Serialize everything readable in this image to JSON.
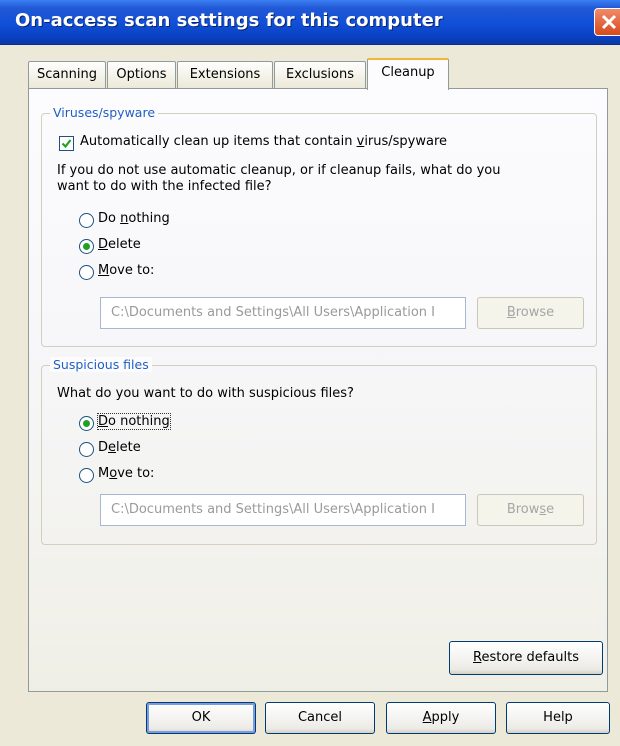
{
  "window": {
    "title": "On-access scan settings for this computer"
  },
  "tabs": [
    {
      "label": "Scanning"
    },
    {
      "label": "Options"
    },
    {
      "label": "Extensions"
    },
    {
      "label": "Exclusions"
    },
    {
      "label": "Cleanup"
    }
  ],
  "active_tab": "Cleanup",
  "viruses": {
    "legend": "Viruses/spyware",
    "auto_clean": {
      "pre": "Automatically clean up items that contain ",
      "accel": "v",
      "post": "irus/spyware",
      "checked": true
    },
    "question_line1": "If you do not use automatic cleanup, or if cleanup fails, what do you",
    "question_line2": "want to do with the infected file?",
    "options": [
      {
        "pre": "Do ",
        "accel": "n",
        "post": "othing",
        "selected": false
      },
      {
        "pre": "",
        "accel": "D",
        "post": "elete",
        "selected": true
      },
      {
        "pre": "",
        "accel": "M",
        "post": "ove to:",
        "selected": false
      }
    ],
    "path_value": "C:\\Documents and Settings\\All Users\\Application I",
    "browse": {
      "pre": "",
      "accel": "B",
      "post": "rowse",
      "enabled": false
    }
  },
  "suspicious": {
    "legend": "Suspicious files",
    "question": "What do you want to do with suspicious files?",
    "options": [
      {
        "pre": "",
        "accel": "D",
        "post": "o nothing",
        "selected": true
      },
      {
        "pre": "D",
        "accel": "e",
        "post": "lete",
        "selected": false
      },
      {
        "pre": "M",
        "accel": "o",
        "post": "ve to:",
        "selected": false
      }
    ],
    "path_value": "C:\\Documents and Settings\\All Users\\Application I",
    "browse": {
      "pre": "Brow",
      "accel": "s",
      "post": "e",
      "enabled": false
    }
  },
  "restore_defaults": {
    "pre": "",
    "accel": "R",
    "post": "estore defaults"
  },
  "footer": {
    "ok": "OK",
    "cancel": "Cancel",
    "apply": {
      "pre": "",
      "accel": "A",
      "post": "pply"
    },
    "help": "Help"
  },
  "colors": {
    "title_bar": "#0f4fd8",
    "dialog_bg": "#ece9d8",
    "legend_text": "#1f5fc4",
    "radio_dot": "#21a121",
    "tab_highlight": "#f2b53c"
  }
}
